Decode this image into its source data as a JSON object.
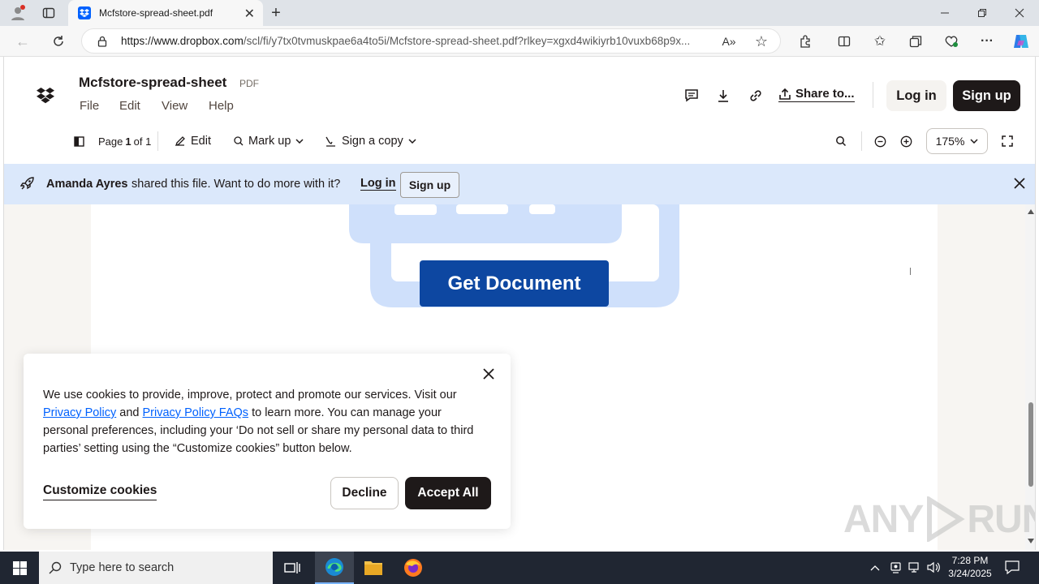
{
  "browser": {
    "tab_title": "Mcfstore-spread-sheet.pdf",
    "url_host": "https://www.dropbox.com",
    "url_path": "/scl/fi/y7tx0tvmuskpae6a4to5i/Mcfstore-spread-sheet.pdf?rlkey=xgxd4wikiyrb10vuxb68p9x..."
  },
  "app": {
    "doc_title": "Mcfstore-spread-sheet",
    "doc_type": "PDF",
    "menus": [
      "File",
      "Edit",
      "View",
      "Help"
    ],
    "share_label": "Share to...",
    "login_label": "Log in",
    "signup_label": "Sign up"
  },
  "toolbar": {
    "page_label_prefix": "Page ",
    "page_current": "1",
    "page_label_suffix": " of 1",
    "edit_label": "Edit",
    "markup_label": "Mark up",
    "sign_label": "Sign a copy",
    "zoom_value": "175%"
  },
  "banner": {
    "sharer": "Amanda Ayres",
    "message": "shared this file. Want to do more with it?",
    "login_label": "Log in",
    "signup_label": "Sign up"
  },
  "document": {
    "button_label": "Get Document"
  },
  "cookie": {
    "text_1": "We use cookies to provide, improve, protect and promote our services. Visit our",
    "link_1": "Privacy Policy",
    "text_and": "and",
    "link_2": "Privacy Policy FAQs",
    "text_2": "to learn more. You can manage your personal preferences, including your ‘Do not sell or share my personal data to third parties’ setting using the “Customize cookies” button below.",
    "customize_label": "Customize cookies",
    "decline_label": "Decline",
    "accept_label": "Accept All"
  },
  "taskbar": {
    "search_placeholder": "Type here to search",
    "time": "7:28 PM",
    "date": "3/24/2025"
  },
  "watermark": "ANY RUN",
  "colors": {
    "banner_bg": "#dbe8fb",
    "dark_button": "#1e1919",
    "doc_button": "#0d47a1",
    "doc_shape": "#cfe0fb",
    "link": "#0061fe",
    "taskbar": "#202632"
  }
}
